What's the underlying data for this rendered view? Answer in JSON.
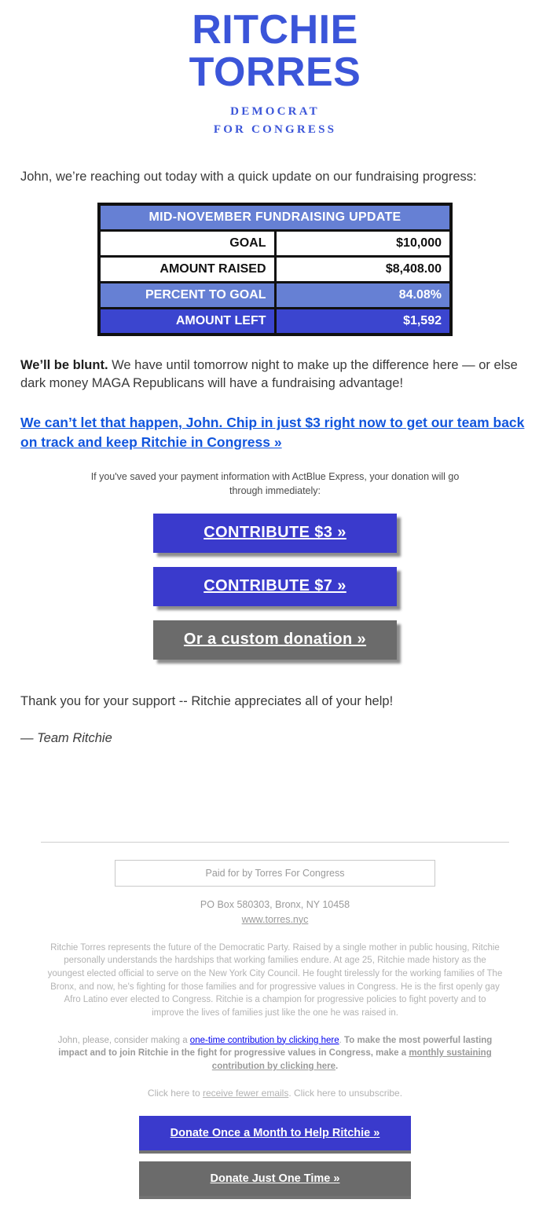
{
  "brand": {
    "accent_blue": "#3B55D9",
    "button_blue": "#3A3ACC",
    "button_gray": "#6B6B6B",
    "link_blue": "#1155DD",
    "table_header_blue": "#6680D4",
    "table_strong_blue": "#3B45CF",
    "name_line1": "RITCHIE",
    "name_line2": "TORRES",
    "tagline_line1": "DEMOCRAT",
    "tagline_line2": "FOR CONGRESS"
  },
  "body": {
    "greeting": "John, we’re reaching out today with a quick update on our fundraising progress:",
    "pitch_bold": "We’ll be blunt.",
    "pitch_rest": " We have until tomorrow night to make up the difference here — or else dark money MAGA Republicans will have a fundraising advantage!",
    "big_link": "We can’t let that happen, John. Chip in just $3 right now to get our team back on track and keep Ritchie in Congress »",
    "express_note": "If you've saved your payment information with ActBlue Express, your donation will go through immediately:",
    "thanks": "Thank you for your support -- Ritchie appreciates all of your help!",
    "signoff": "— Team Ritchie"
  },
  "table": {
    "header": "MID-NOVEMBER FUNDRAISING UPDATE",
    "rows": [
      {
        "label": "GOAL",
        "value": "$10,000",
        "style": "plain"
      },
      {
        "label": "AMOUNT RAISED",
        "value": "$8,408.00",
        "style": "plain"
      },
      {
        "label": "PERCENT TO GOAL",
        "value": "84.08%",
        "style": "accent"
      },
      {
        "label": "AMOUNT LEFT",
        "value": "$1,592",
        "style": "accent-strong"
      }
    ]
  },
  "cta_buttons": [
    {
      "label": "CONTRIBUTE $3 »",
      "style": "blue"
    },
    {
      "label": "CONTRIBUTE $7 »",
      "style": "blue"
    },
    {
      "label": "Or a custom donation »",
      "style": "gray"
    }
  ],
  "footer": {
    "paid_for": "Paid for by Torres For Congress",
    "address": "PO Box 580303, Bronx, NY 10458",
    "website": "www.torres.nyc",
    "bio": "Ritchie Torres represents the future of the Democratic Party. Raised by a single mother in public housing, Ritchie personally understands the hardships that working families endure. At age 25, Ritchie made history as the youngest elected official to serve on the New York City Council. He fought tirelessly for the working families of The Bronx, and now, he's fighting for those families and for progressive values in Congress. He is the first openly gay Afro Latino ever elected to Congress. Ritchie is a champion for progressive policies to fight poverty and to improve the lives of families just like the one he was raised in.",
    "ask_part1": "John, please, consider making a ",
    "ask_link1": "one-time contribution by clicking here",
    "ask_part2": ". ",
    "ask_bold": "To make the most powerful lasting impact and to join Ritchie in the fight for progressive values in Congress, make a ",
    "ask_link2": "monthly sustaining contribution by clicking here",
    "ask_end": ".",
    "unsub_part1": "Click here to ",
    "unsub_link": "receive fewer emails",
    "unsub_part2": ". Click here to unsubscribe.",
    "buttons": [
      {
        "label": "Donate Once a Month to Help Ritchie »",
        "style": "blue"
      },
      {
        "label": "Donate Just One Time »",
        "style": "gray"
      }
    ]
  }
}
